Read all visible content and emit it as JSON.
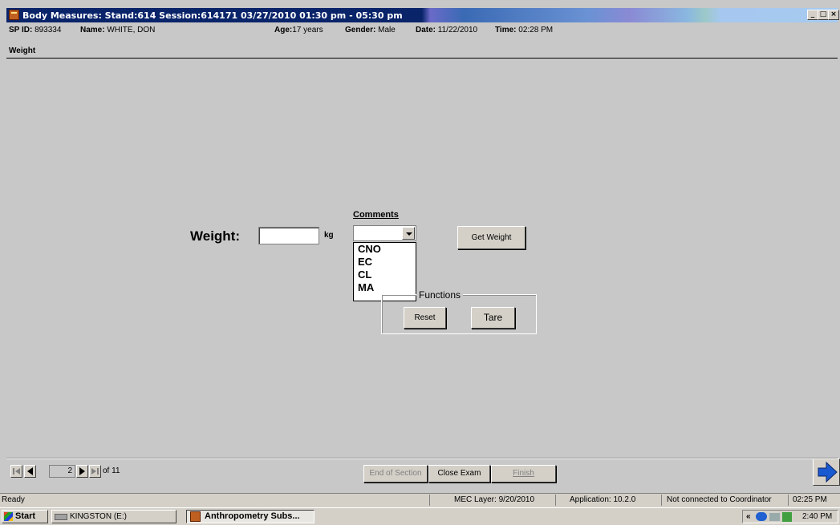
{
  "window": {
    "title": "Body Measures: Stand:614 Session:614171 03/27/2010 01:30 pm - 05:30 pm",
    "minimize_label": "_",
    "maximize_label": "□",
    "close_label": "×"
  },
  "participant": {
    "sp_id_label": "SP ID:",
    "sp_id": "893334",
    "name_label": "Name:",
    "name": "WHITE, DON",
    "age_label": "Age:",
    "age": "17 years",
    "gender_label": "Gender:",
    "gender": "Male",
    "date_label": "Date:",
    "date": "11/22/2010",
    "time_label": "Time:",
    "time": "02:28 PM"
  },
  "section": {
    "title": "Weight"
  },
  "form": {
    "weight_label": "Weight:",
    "weight_value": "",
    "unit": "kg",
    "comments_label": "Comments",
    "comments_value": "",
    "comments_options": [
      "CNO",
      "EC",
      "CL",
      "MA"
    ],
    "get_weight_label": "Get Weight",
    "functions_label": "Functions",
    "reset_label": "Reset",
    "tare_label": "Tare"
  },
  "navigation": {
    "page": "2",
    "of_label": "of 11",
    "end_of_section_label": "End of Section",
    "close_exam_label": "Close Exam",
    "finish_label": "Finish"
  },
  "statusbar": {
    "status": "Ready",
    "mec_layer": "MEC Layer: 9/20/2010",
    "application": "Application: 10.2.0",
    "connection": "Not connected to Coordinator",
    "time": "02:25 PM"
  },
  "taskbar": {
    "start_label": "Start",
    "drive_label": "KINGSTON (E:)",
    "app_label": "Anthropometry Subs...",
    "tray_chevron": "«",
    "clock": "2:40 PM"
  }
}
